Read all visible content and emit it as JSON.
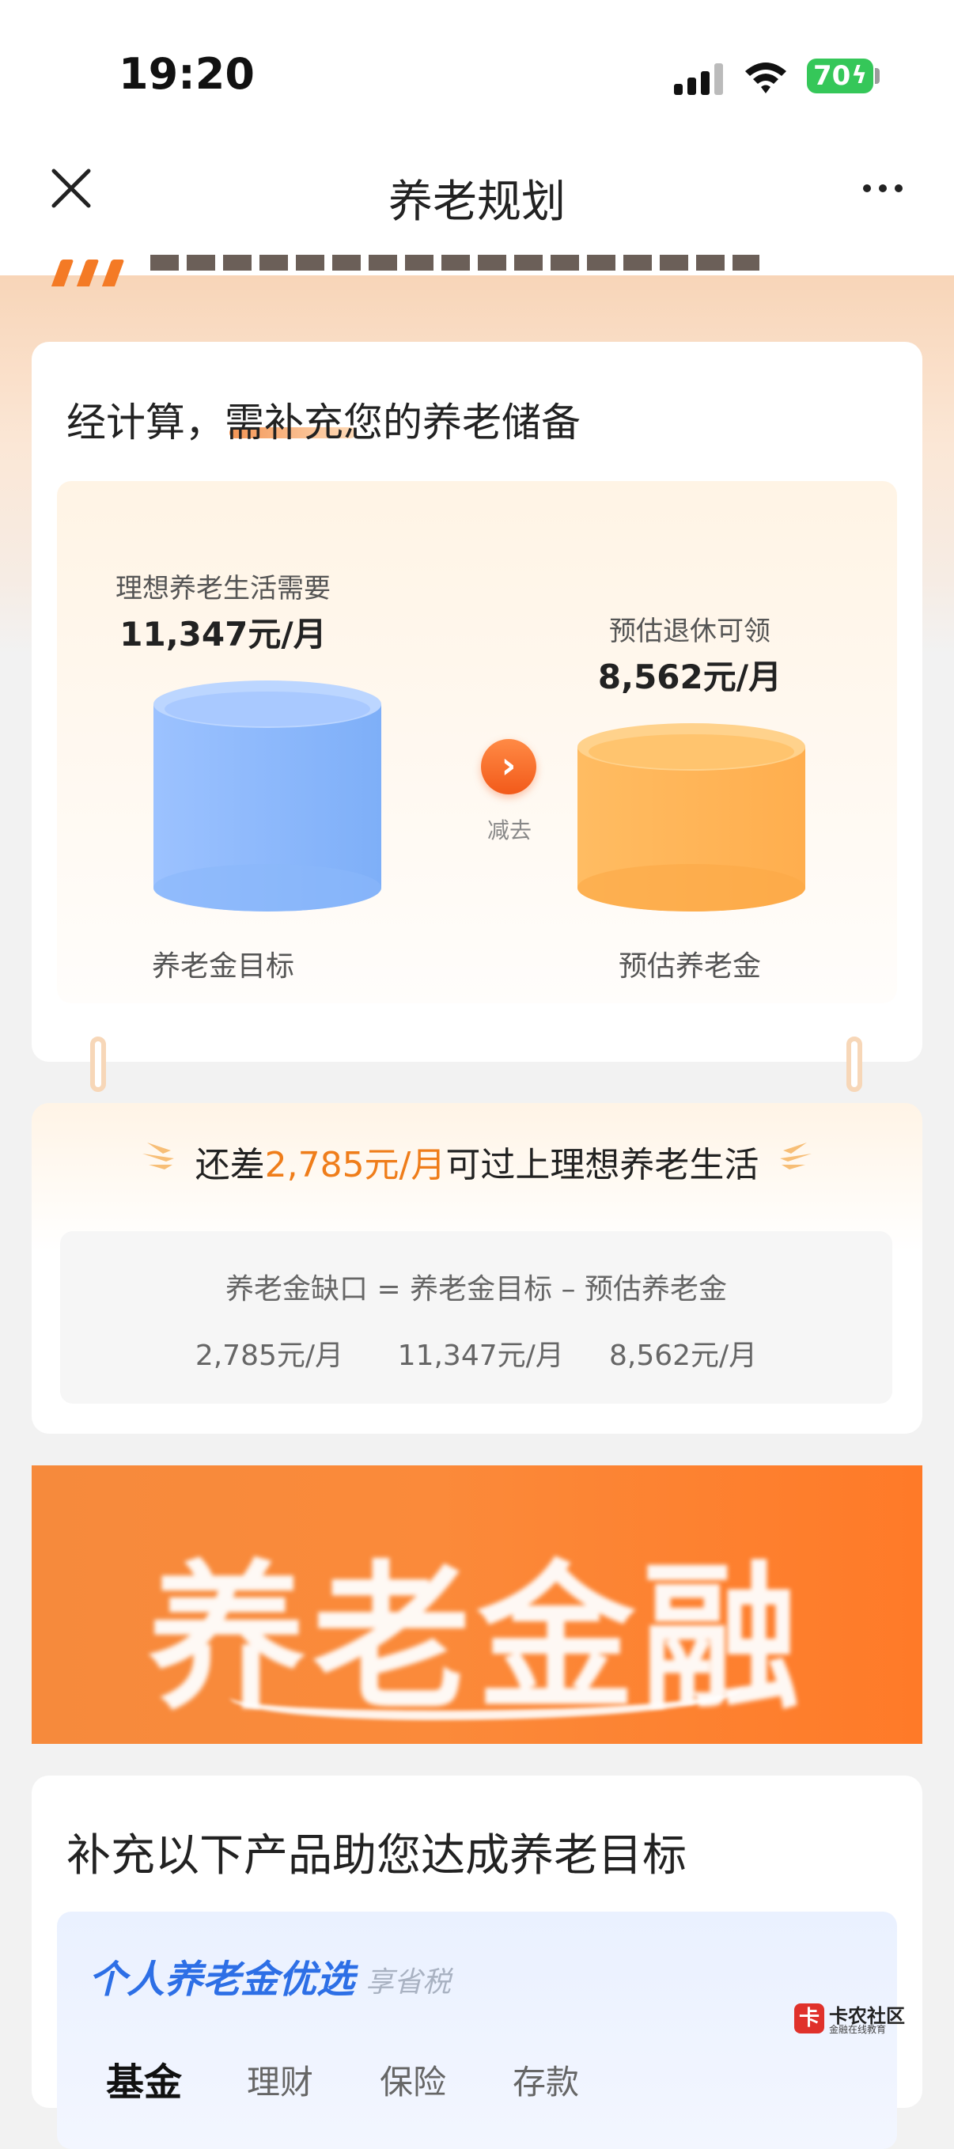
{
  "status_bar": {
    "time": "19:20",
    "battery": "70"
  },
  "nav": {
    "title": "养老规划"
  },
  "card_gap": {
    "title": "经计算，需补充您的养老储备",
    "ideal_label": "理想养老生活需要",
    "ideal_value": "11,347元/月",
    "arrow_label": "减去",
    "pension_label": "预估退休可领",
    "pension_value": "8,562元/月",
    "target_caption": "养老金目标",
    "pension_caption": "预估养老金"
  },
  "gap_summary": {
    "prefix": "还差",
    "amount": "2,785元/月",
    "suffix": "可过上理想养老生活",
    "formula_labels": "养老金缺口 = 养老金目标 – 预估养老金",
    "formula_values": "2,785元/月      11,347元/月     8,562元/月"
  },
  "banner": {
    "text": "养老金融"
  },
  "products": {
    "title": "补充以下产品助您达成养老目标",
    "section_title": "个人养老金优选",
    "section_sub": "享省税",
    "tabs": [
      "基金",
      "理财",
      "保险",
      "存款"
    ]
  },
  "watermark": {
    "logo": "卡",
    "name": "卡农社区",
    "sub": "金融在线教育"
  },
  "colors": {
    "accent": "#ef7d1a",
    "blue": "#2d6fe6",
    "battery": "#35c759"
  }
}
